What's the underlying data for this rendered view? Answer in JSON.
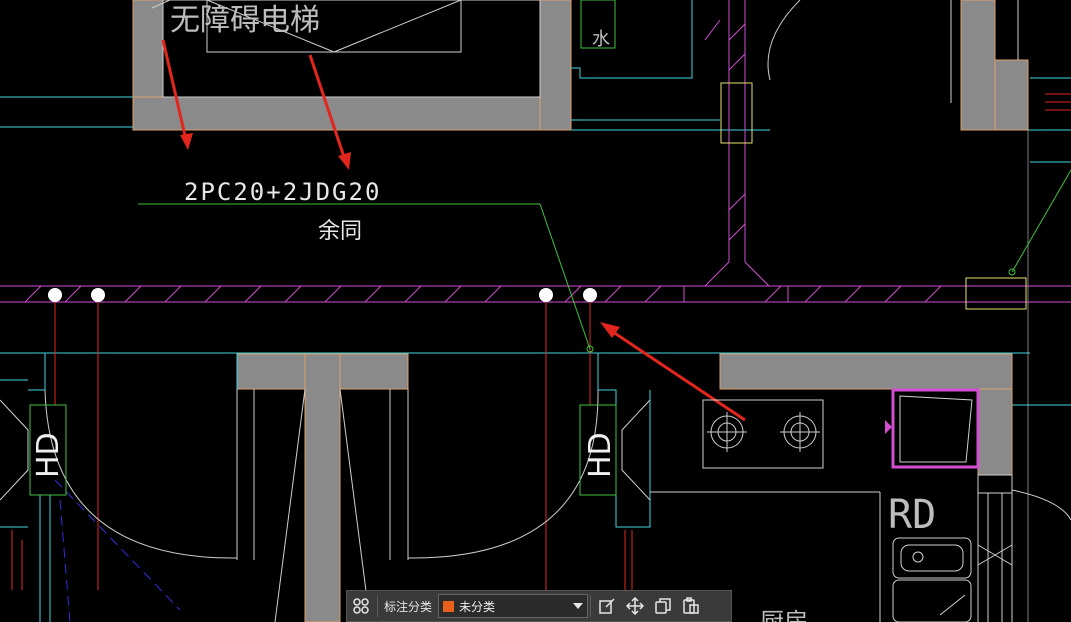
{
  "drawing": {
    "elevator_label": "无障碍电梯",
    "cable_spec": "2PC20+2JDG20",
    "cable_note": "余同",
    "outlet_label_1": "HD",
    "outlet_label_2": "HD",
    "fridge_label": "RD",
    "room_label_partial": "厨房",
    "water_label": "水"
  },
  "toolbar": {
    "label": "标注分类",
    "category_value": "未分类",
    "category_color": "#e8601c",
    "icons": [
      "group-icon",
      "edit-icon",
      "move-icon",
      "copy-icon",
      "paste-icon",
      "dropdown-icon"
    ]
  },
  "colors": {
    "wall": "#8a8a8a",
    "wall_edge": "#d9a06a",
    "magenta": "#d24fd2",
    "cyan": "#3fd6e0",
    "green": "#3fc23f",
    "red": "#e2261d",
    "yellow": "#e8e070"
  }
}
